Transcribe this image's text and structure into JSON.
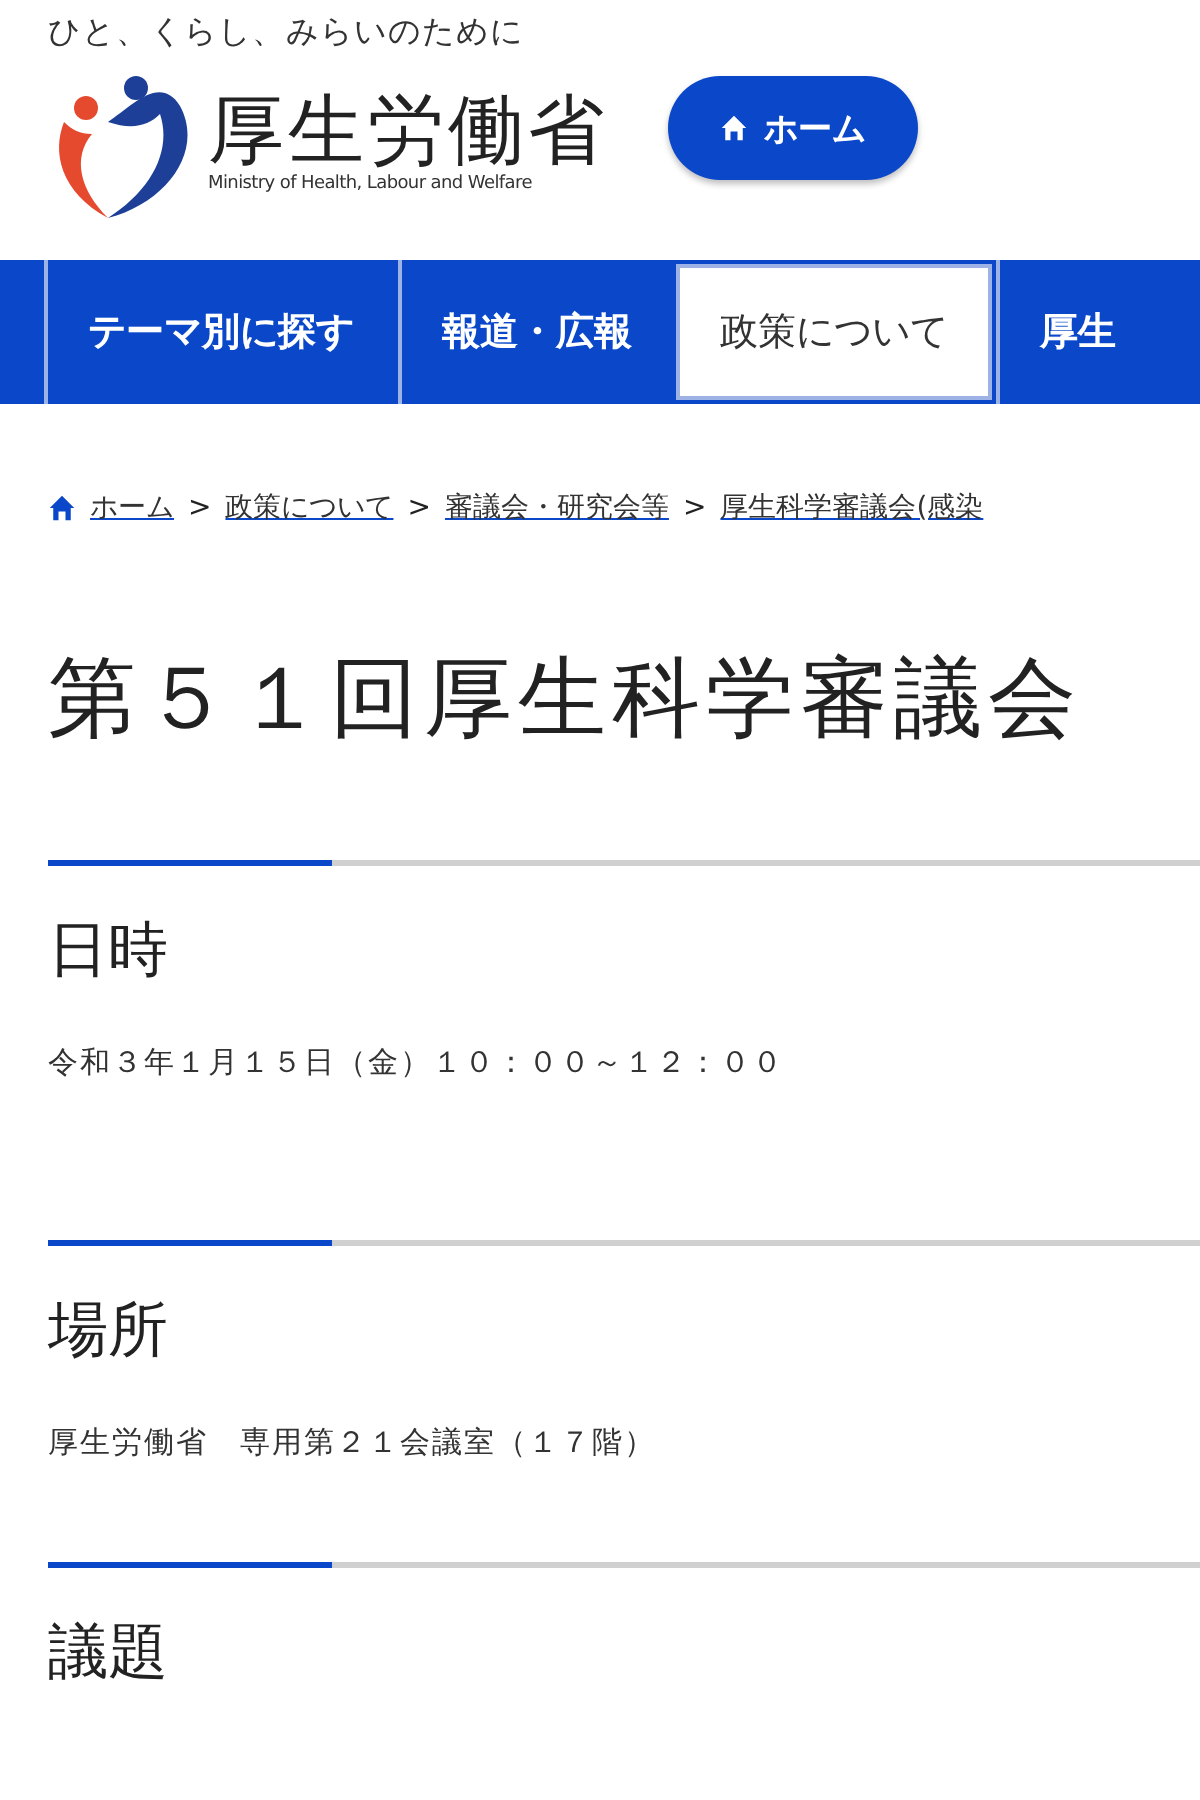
{
  "header": {
    "tagline": "ひと、くらし、みらいのために",
    "logo_text": "厚生労働省",
    "logo_subtitle": "Ministry of Health, Labour and Welfare",
    "home_button": "ホーム"
  },
  "nav": [
    {
      "label": "テーマ別に探す",
      "selected": false
    },
    {
      "label": "報道・広報",
      "selected": false
    },
    {
      "label": "政策について",
      "selected": true
    },
    {
      "label": "厚生",
      "selected": false
    }
  ],
  "breadcrumb": {
    "separator": ">",
    "items": [
      "ホーム",
      "政策について",
      "審議会・研究会等",
      "厚生科学審議会(感染"
    ]
  },
  "title": "第５１回厚生科学審議会",
  "sections": [
    {
      "heading": "日時",
      "body": "令和３年１月１５日（金）１０：００～１２：００"
    },
    {
      "heading": "場所",
      "body": "厚生労働省　専用第２１会議室（１７階）"
    },
    {
      "heading": "議題"
    }
  ]
}
